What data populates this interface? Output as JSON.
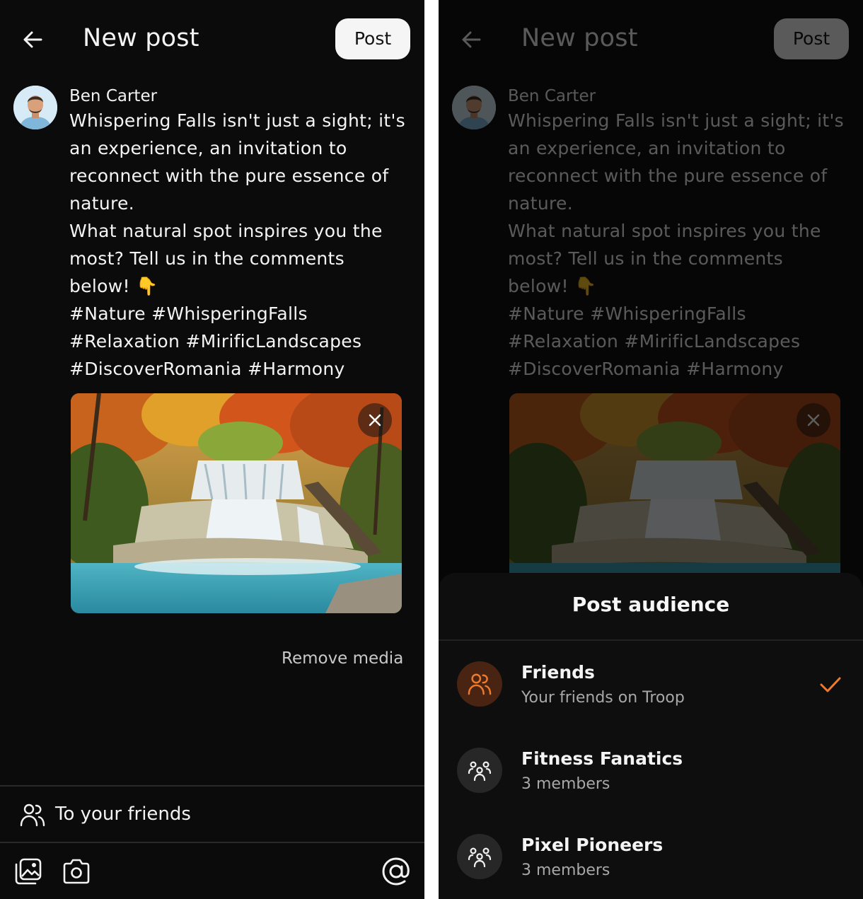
{
  "composer": {
    "title": "New post",
    "post_label": "Post",
    "author": "Ben Carter",
    "text_lines": [
      "Whispering Falls isn't just a sight; it's",
      "an experience, an invitation to",
      "reconnect with the pure essence of",
      "nature.",
      "What natural spot inspires you the",
      "most? Tell us in the comments",
      "below! 👇",
      "#Nature #WhisperingFalls",
      "#Relaxation #MirificLandscapes",
      "#DiscoverRomania #Harmony"
    ],
    "remove_media_label": "Remove media",
    "audience_label": "To your friends",
    "icons": {
      "back": "arrow-left-icon",
      "close_media": "close-icon",
      "audience": "people-icon",
      "gallery": "gallery-icon",
      "camera": "camera-icon",
      "mention": "at-sign-icon"
    }
  },
  "audience_sheet": {
    "title": "Post audience",
    "options": [
      {
        "name": "Friends",
        "subtitle": "Your friends on Troop",
        "selected": true,
        "icon": "friends-icon"
      },
      {
        "name": "Fitness Fanatics",
        "subtitle": "3 members",
        "selected": false,
        "icon": "group-icon"
      },
      {
        "name": "Pixel Pioneers",
        "subtitle": "3 members",
        "selected": false,
        "icon": "group-icon"
      }
    ],
    "check_icon": "checkmark-icon"
  },
  "colors": {
    "background": "#0b0b0b",
    "accent": "#f07a2c",
    "accent_bg": "#4a2412",
    "post_button": "#f5f5f5"
  }
}
